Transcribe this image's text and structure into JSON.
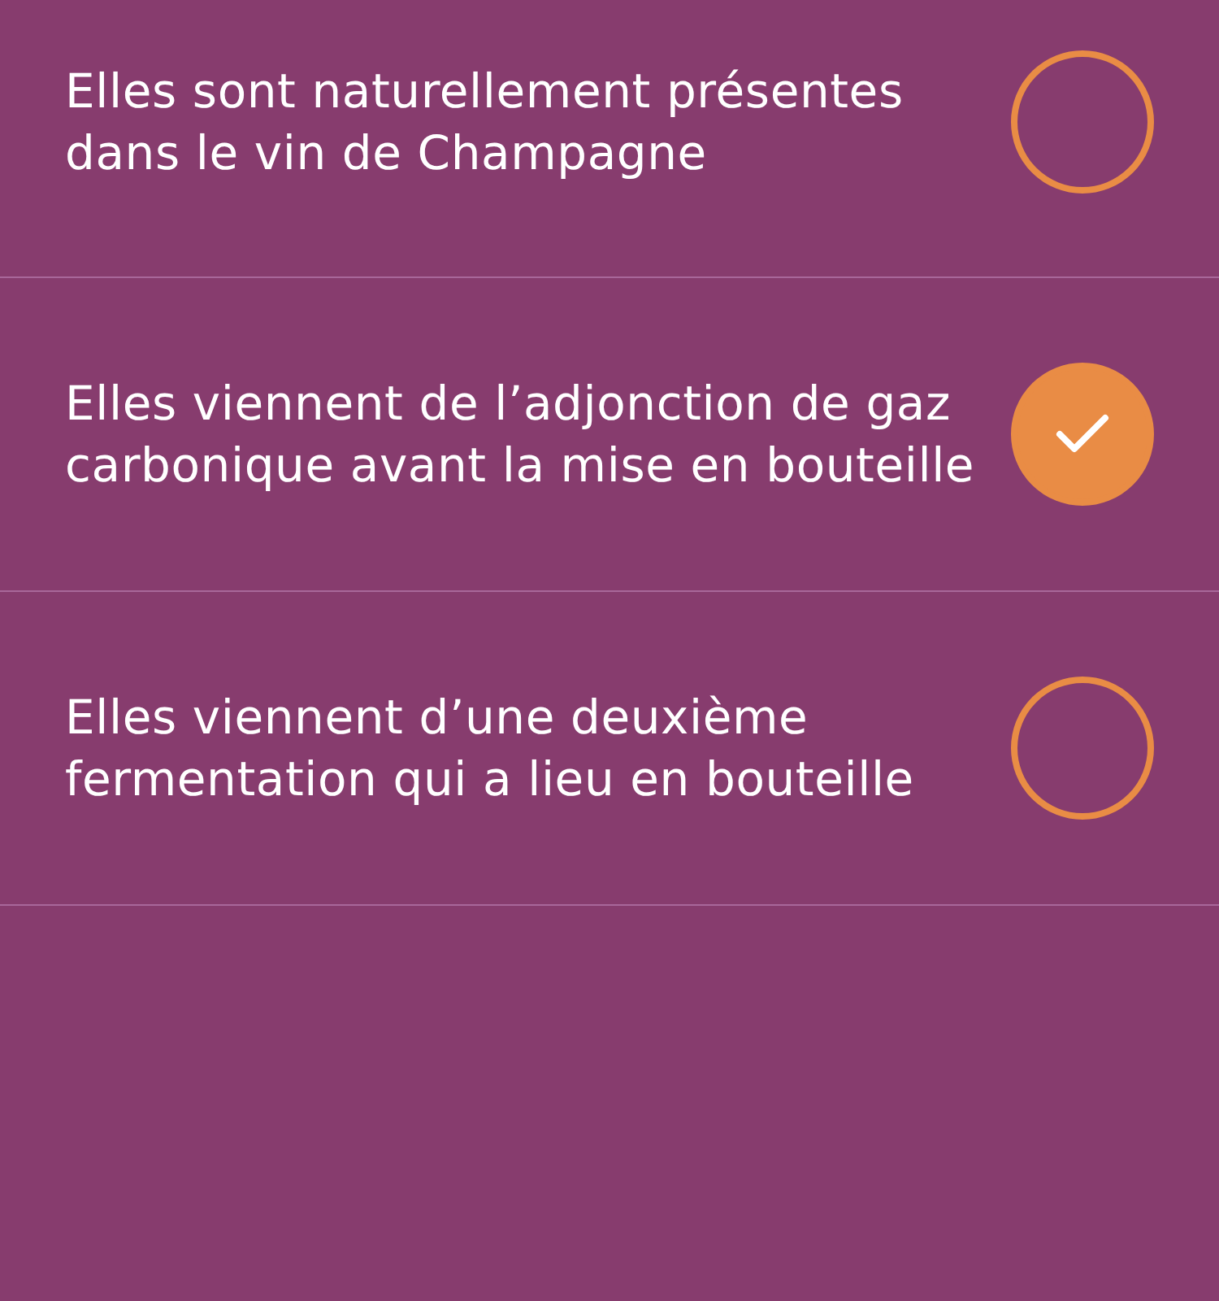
{
  "options": [
    {
      "text": "Elles sont naturellement présentes dans le vin de Champagne",
      "selected": false
    },
    {
      "text": "Elles viennent de l’adjonction de gaz carbonique avant la mise en bouteille",
      "selected": true
    },
    {
      "text": "Elles viennent d’une deuxième fermentation qui a lieu en bouteille",
      "selected": false
    }
  ]
}
